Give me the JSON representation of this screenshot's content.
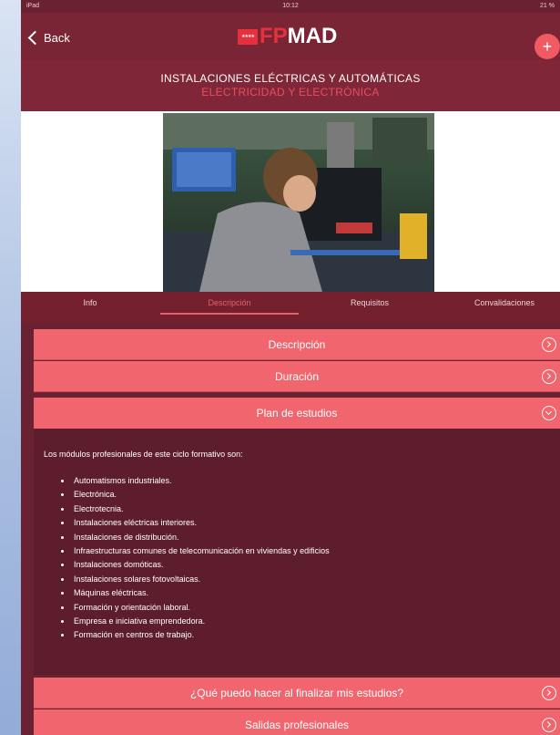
{
  "status_bar": {
    "left": "iPad",
    "time": "10:12",
    "battery": "21 %"
  },
  "nav": {
    "back_label": "Back",
    "logo_flag": "★★★★",
    "logo_fp": "FP",
    "logo_mad": "MAD",
    "plus_label": "+"
  },
  "header": {
    "title": "INSTALACIONES ELÉCTRICAS Y AUTOMÁTICAS",
    "subtitle": "ELECTRICIDAD Y ELECTRÓNICA"
  },
  "tabs": [
    {
      "label": "Info",
      "active": false
    },
    {
      "label": "Descripción",
      "active": true
    },
    {
      "label": "Requisitos",
      "active": false
    },
    {
      "label": "Convalidaciones",
      "active": false
    }
  ],
  "accordion": [
    {
      "label": "Descripción",
      "expanded": false
    },
    {
      "label": "Duración",
      "expanded": false
    },
    {
      "label": "Plan de estudios",
      "expanded": true
    },
    {
      "label": "¿Qué puedo hacer al finalizar mis estudios?",
      "expanded": false
    },
    {
      "label": "Salidas profesionales",
      "expanded": false
    }
  ],
  "plan": {
    "intro": "Los módulos profesionales de este ciclo formativo son:",
    "modules": [
      "Automatismos industriales.",
      "Electrónica.",
      "Electrotecnia.",
      "Instalaciones eléctricas interiores.",
      "Instalaciones de distribución.",
      "Infraestructuras comunes de telecomunicación en viviendas y edificios",
      "Instalaciones domóticas.",
      "Instalaciones solares fotovoltaicas.",
      "Máquinas eléctricas.",
      "Formación y orientación laboral.",
      "Empresa e iniciativa emprendedora.",
      "Formación en centros de trabajo."
    ]
  },
  "colors": {
    "accent": "#f0656e",
    "brand_red": "#e6313c",
    "dark": "#6a2233"
  },
  "icons": {
    "back": "chevron-left-icon",
    "add": "plus-icon",
    "expand": "circle-chevron-right-icon",
    "collapse": "circle-chevron-down-icon"
  }
}
